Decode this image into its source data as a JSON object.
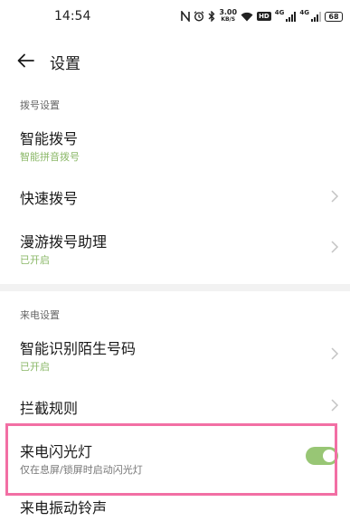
{
  "status_bar": {
    "time": "14:54",
    "icons": [
      "nfc-icon",
      "alarm-icon",
      "bluetooth-icon",
      "wifi-icon",
      "hd-icon",
      "signal-icon",
      "signal-icon",
      "battery-icon"
    ],
    "net_speed_value": "3.00",
    "net_speed_unit": "KB/S",
    "hd_label": "HD",
    "signal_label_1": "4G",
    "signal_label_2": "4G",
    "battery_level": "68"
  },
  "header": {
    "title": "设置"
  },
  "sections": [
    {
      "header": "拨号设置",
      "items": [
        {
          "title": "智能拨号",
          "subtitle": "智能拼音拨号",
          "subtitle_color": "#8bb868"
        },
        {
          "title": "快速拨号"
        },
        {
          "title": "漫游拨号助理",
          "subtitle": "已开启",
          "subtitle_color": "#8bb868"
        }
      ]
    },
    {
      "header": "来电设置",
      "items": [
        {
          "title": "智能识别陌生号码",
          "subtitle": "已开启",
          "subtitle_color": "#8bb868"
        },
        {
          "title": "拦截规则"
        },
        {
          "title": "来电闪光灯",
          "subtitle": "仅在息屏/锁屏时启动闪光灯",
          "toggle_on": true
        },
        {
          "title": "来电振动铃声"
        }
      ]
    }
  ],
  "colors": {
    "accent_green": "#98c675",
    "highlight_border": "#f26fa4"
  }
}
